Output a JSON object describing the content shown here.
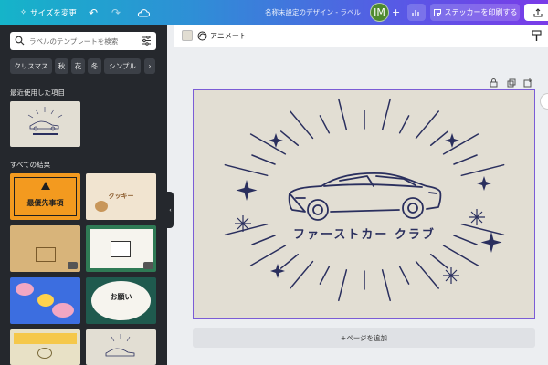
{
  "topbar": {
    "resize_label": "サイズを変更",
    "doc_title": "名称未設定のデザイン - ラベル",
    "avatar_initials": "IM",
    "add_label": "+",
    "share_label": "ステッカーを印刷する"
  },
  "sidebar": {
    "search_placeholder": "ラベルのテンプレートを検索",
    "chips": [
      "クリスマス",
      "秋",
      "花",
      "冬",
      "シンプル"
    ],
    "recent_title": "最近使用した項目",
    "all_title": "すべての結果",
    "thumbs": [
      {
        "text": "最優先事項",
        "bg": "#f39a1f"
      },
      {
        "text": "クッキー",
        "bg": "#f1e4d0"
      },
      {
        "text": "",
        "bg": "#d8b47a"
      },
      {
        "text": "",
        "bg": "#2f7a55"
      },
      {
        "text": "",
        "bg": "#3c6ee0"
      },
      {
        "text": "お願い",
        "bg": "#1f5a4e"
      },
      {
        "text": "",
        "bg": "#e8e1c6"
      },
      {
        "text": "",
        "bg": "#e2ded3"
      }
    ]
  },
  "editbar": {
    "animate_label": "アニメート"
  },
  "canvas": {
    "title": "ファーストカー クラブ",
    "bg_color": "#e2ded3",
    "ink_color": "#2a2f5e"
  },
  "footer": {
    "add_page_label": "+ページを追加"
  }
}
